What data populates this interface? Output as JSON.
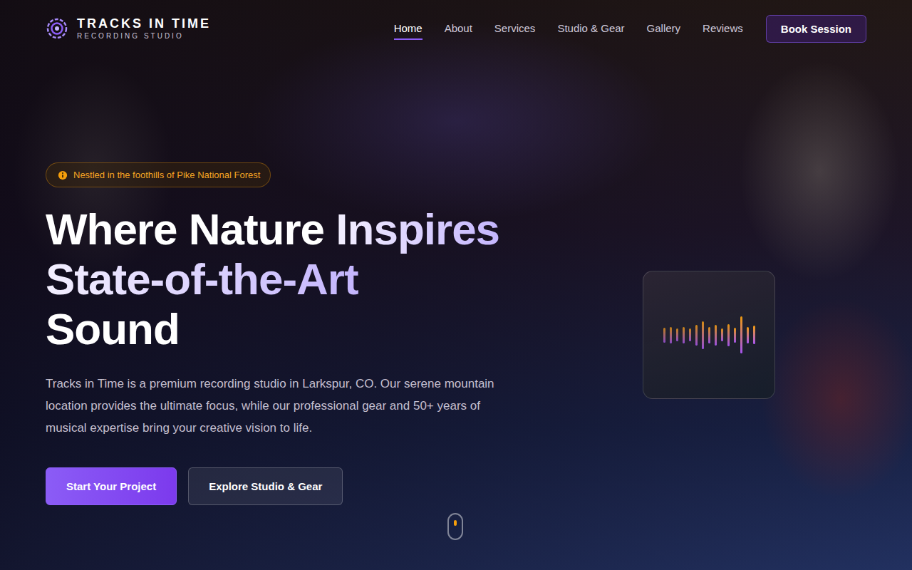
{
  "brand": {
    "name": "TRACKS IN TIME",
    "tagline": "RECORDING STUDIO"
  },
  "nav": [
    {
      "label": "Home",
      "selected": true
    },
    {
      "label": "About",
      "selected": false
    },
    {
      "label": "Services",
      "selected": false
    },
    {
      "label": "Studio & Gear",
      "selected": false
    },
    {
      "label": "Gallery",
      "selected": false
    },
    {
      "label": "Reviews",
      "selected": false
    }
  ],
  "nav_button": "Book Session",
  "hero": {
    "badge": "Nestled in the foothills of Pike National Forest",
    "title_lines": [
      [
        {
          "text": "Where Nature ",
          "accent": false
        },
        {
          "text": "Inspires",
          "accent": true
        }
      ],
      [
        {
          "text": "State-of-the-Art",
          "accent": true
        }
      ],
      [
        {
          "text": "Sound",
          "accent": false
        }
      ]
    ],
    "description": "Tracks in Time is a premium recording studio in Larkspur, CO. Our serene mountain location provides the ultimate focus, while our professional gear and 50+ years of musical expertise bring your creative vision to life.",
    "buttons": [
      {
        "label": "Start Your Project",
        "kind": "primary"
      },
      {
        "label": "Explore Studio & Gear",
        "kind": "secondary"
      }
    ]
  },
  "waveform": [
    0.4,
    0.45,
    0.35,
    0.45,
    0.35,
    0.55,
    0.75,
    0.45,
    0.55,
    0.35,
    0.6,
    0.4,
    1.0,
    0.45,
    0.5
  ]
}
